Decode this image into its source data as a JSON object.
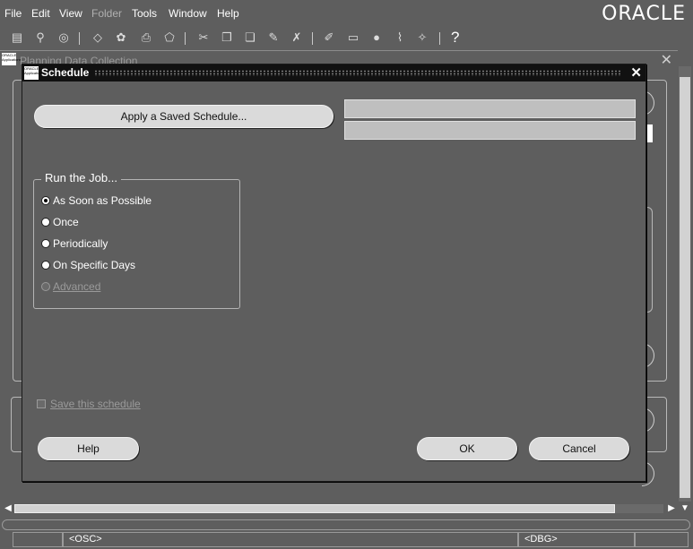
{
  "menubar": {
    "items": [
      {
        "label": "File"
      },
      {
        "label": "Edit"
      },
      {
        "label": "View"
      },
      {
        "label": "Folder"
      },
      {
        "label": "Tools"
      },
      {
        "label": "Window"
      },
      {
        "label": "Help"
      }
    ],
    "brand": "ORACLE"
  },
  "toolbar": {
    "icons": [
      "new-icon",
      "find-icon",
      "navigator-icon",
      "save-icon",
      "print-icon",
      "close-form-icon",
      "cut-icon",
      "copy-icon",
      "paste-icon",
      "clear-icon",
      "delete-icon",
      "edit-icon",
      "folder-icon",
      "translation-icon",
      "attachments-icon",
      "zoom-icon",
      "help-icon"
    ],
    "help_glyph": "?"
  },
  "background_window": {
    "title": "Planning Data Collection",
    "logo": "ORACLE Applications"
  },
  "dialog": {
    "title": "Schedule",
    "logo": "ORACLE Applications",
    "apply_saved_label": "Apply a Saved Schedule...",
    "run_group_label": "Run the Job...",
    "options": [
      {
        "label": "As Soon as Possible",
        "selected": true,
        "enabled": true
      },
      {
        "label": "Once",
        "selected": false,
        "enabled": true
      },
      {
        "label": "Periodically",
        "selected": false,
        "enabled": true
      },
      {
        "label": "On Specific Days",
        "selected": false,
        "enabled": true
      },
      {
        "label": "Advanced",
        "selected": false,
        "enabled": false
      }
    ],
    "save_schedule_label": "Save this schedule",
    "help_label": "Help",
    "ok_label": "OK",
    "cancel_label": "Cancel",
    "close_glyph": "✕"
  },
  "statusbar": {
    "left": "<OSC>",
    "right": "<DBG>"
  }
}
